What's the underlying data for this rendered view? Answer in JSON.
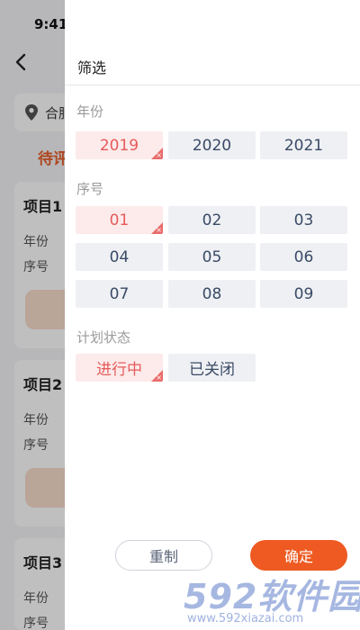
{
  "status_bar": {
    "time": "9:41"
  },
  "background": {
    "location_text": "合肥",
    "tab_label": "待评",
    "cards": [
      {
        "title": "项目1",
        "row1": "年份",
        "row2": "序号"
      },
      {
        "title": "项目2",
        "row1": "年份",
        "row2": "序号"
      },
      {
        "title": "项目3",
        "row1": "年份",
        "row2": "序号"
      }
    ]
  },
  "drawer": {
    "title": "筛选",
    "year_section": {
      "label": "年份",
      "options": [
        {
          "label": "2019",
          "selected": true
        },
        {
          "label": "2020",
          "selected": false
        },
        {
          "label": "2021",
          "selected": false
        }
      ]
    },
    "number_section": {
      "label": "序号",
      "options": [
        {
          "label": "01",
          "selected": true
        },
        {
          "label": "02",
          "selected": false
        },
        {
          "label": "03",
          "selected": false
        },
        {
          "label": "04",
          "selected": false
        },
        {
          "label": "05",
          "selected": false
        },
        {
          "label": "06",
          "selected": false
        },
        {
          "label": "07",
          "selected": false
        },
        {
          "label": "08",
          "selected": false
        },
        {
          "label": "09",
          "selected": false
        }
      ]
    },
    "status_section": {
      "label": "计划状态",
      "options": [
        {
          "label": "进行中",
          "selected": true
        },
        {
          "label": "已关闭",
          "selected": false
        }
      ]
    },
    "reset_label": "重制",
    "confirm_label": "确定"
  },
  "watermark": {
    "brand": "592软件园",
    "url": "www.592xiazai.com"
  },
  "colors": {
    "accent": "#ee5a22",
    "selected_bg": "#fdeaea",
    "selected_text": "#e55b5b",
    "option_bg": "#eef0f3"
  }
}
